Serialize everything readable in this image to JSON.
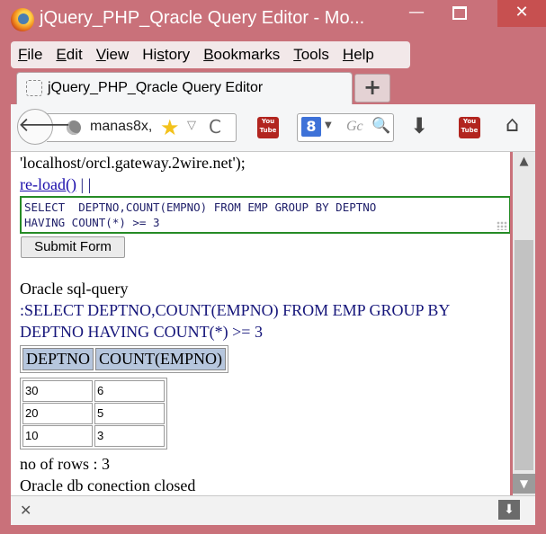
{
  "window": {
    "title": "jQuery_PHP_Qracle Query Editor - Mo...",
    "min_glyph": "—",
    "close_glyph": "✕"
  },
  "menu": [
    {
      "hot": "F",
      "rest": "ile"
    },
    {
      "hot": "E",
      "rest": "dit"
    },
    {
      "hot": "V",
      "rest": "iew"
    },
    {
      "pre": "Hi",
      "hot": "s",
      "rest": "tory"
    },
    {
      "hot": "B",
      "rest": "ookmarks"
    },
    {
      "hot": "T",
      "rest": "ools"
    },
    {
      "hot": "H",
      "rest": "elp"
    }
  ],
  "tab": {
    "label": "jQuery_PHP_Qracle Query Editor",
    "new_tab_glyph": "+"
  },
  "navbar": {
    "back_glyph": "🡐",
    "url": "manas8x,",
    "star_glyph": "★",
    "caret_glyph": "▽",
    "reload_glyph": "C",
    "youtube_text_top": "You",
    "youtube_text_bottom": "Tube",
    "search_engine": "8",
    "search_caret": "▼",
    "search_placeholder": "Gc",
    "search_icon": "🔍",
    "download_glyph": "⬇",
    "home_glyph": "⌂"
  },
  "content": {
    "connection_line": "'localhost/orcl.gateway.2wire.net');",
    "reload_link": "re-load()",
    "reload_sep": " | |",
    "query_text": "SELECT  DEPTNO,COUNT(EMPNO) FROM EMP GROUP BY DEPTNO\nHAVING COUNT(*) >= 3",
    "submit_label": "Submit Form",
    "result_heading": "Oracle sql-query",
    "query_echo_line1": ":SELECT DEPTNO,COUNT(EMPNO) FROM EMP GROUP BY",
    "query_echo_line2": "DEPTNO HAVING COUNT(*) >= 3",
    "columns": [
      "DEPTNO",
      "COUNT(EMPNO)"
    ],
    "rows": [
      [
        "30",
        "6"
      ],
      [
        "20",
        "5"
      ],
      [
        "10",
        "3"
      ]
    ],
    "row_count": "no of rows : 3",
    "closed_msg": "Oracle db conection closed"
  },
  "scrollbar": {
    "up_glyph": "▲",
    "down_glyph": "▼"
  },
  "bottombar": {
    "close_glyph": "✕",
    "download_glyph": "⬇"
  }
}
